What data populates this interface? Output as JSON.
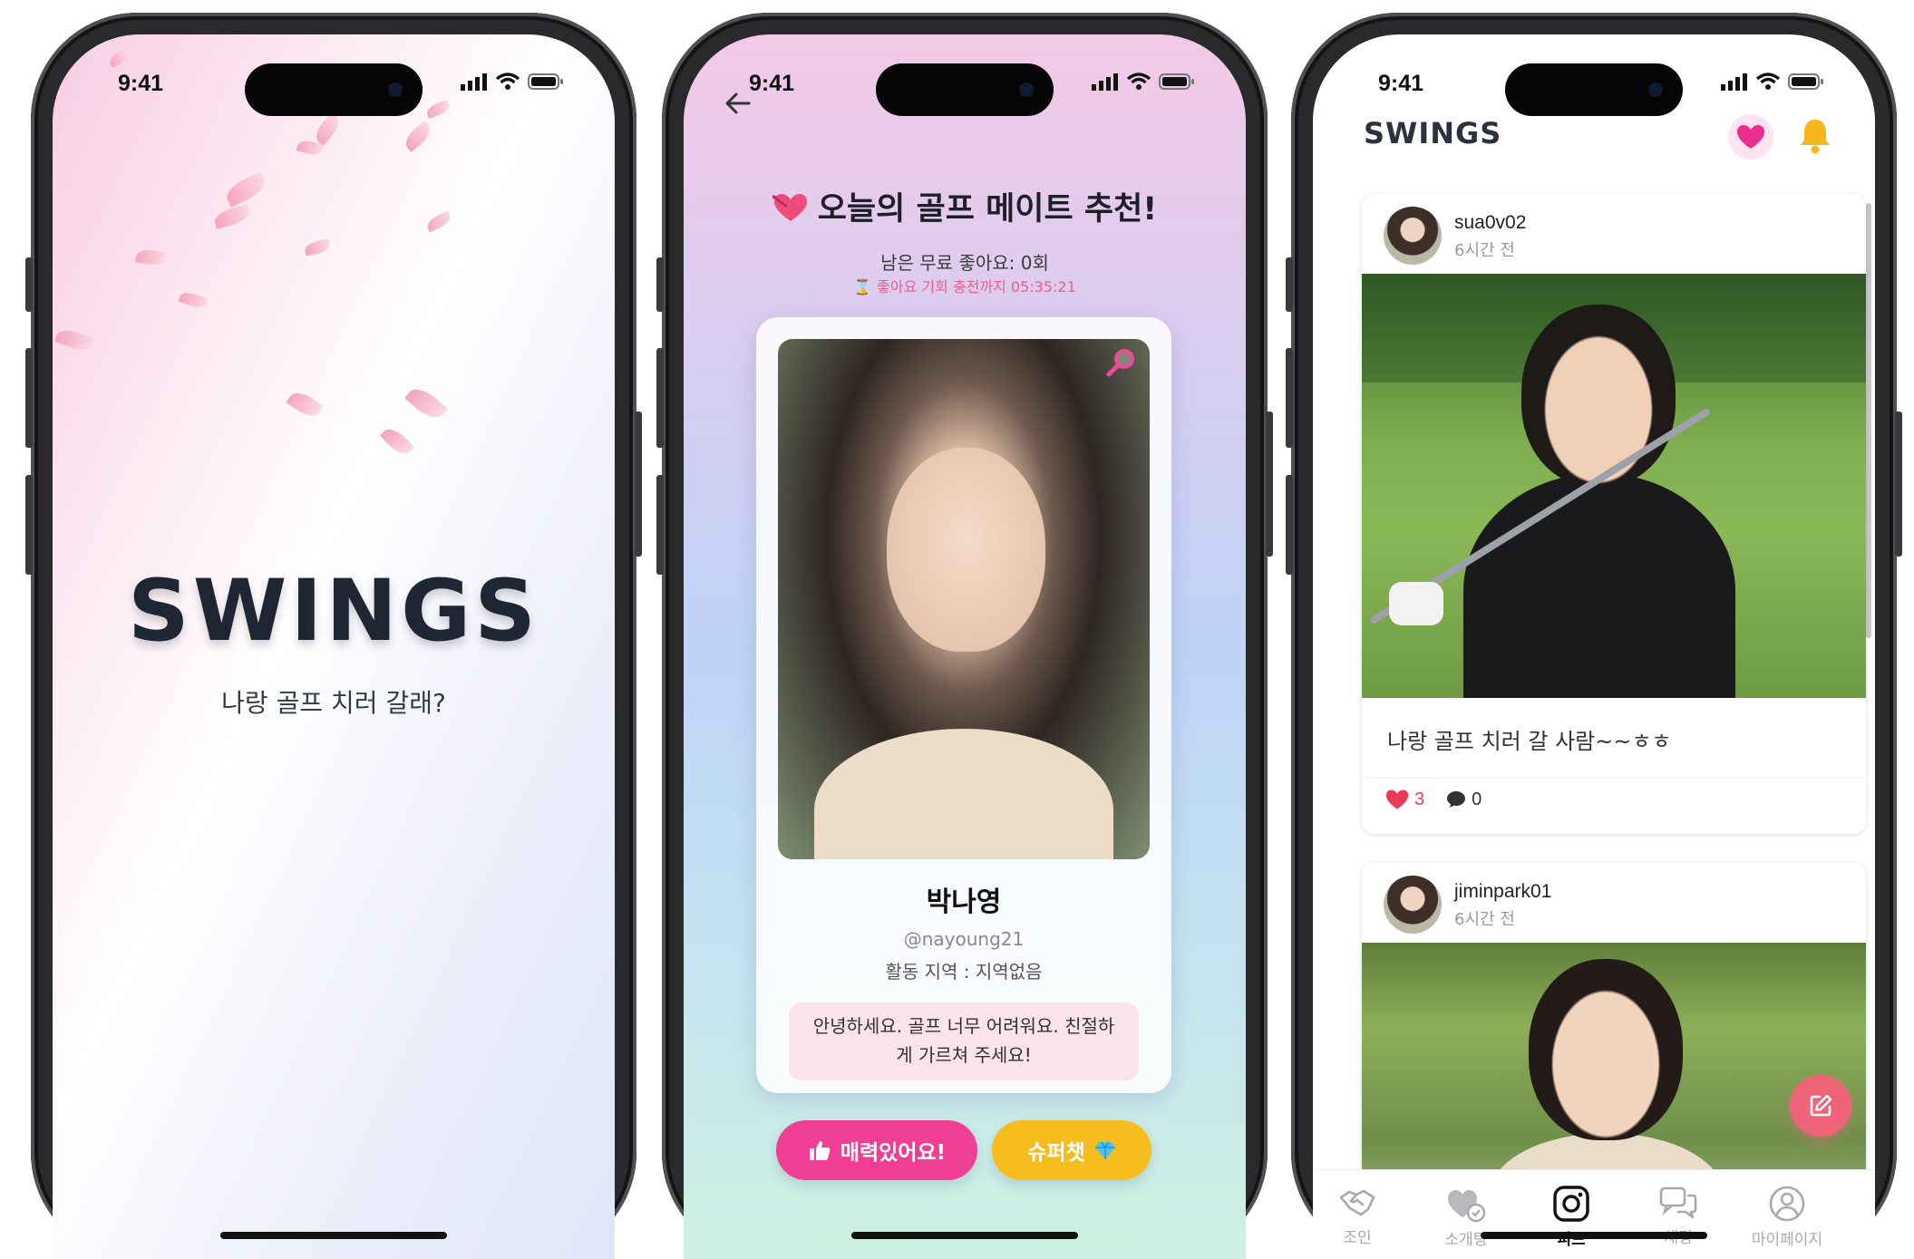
{
  "status": {
    "time": "9:41"
  },
  "splash": {
    "title": "SWINGS",
    "subtitle": "나랑 골프 치러 갈래?"
  },
  "recommend": {
    "title": "오늘의 골프 메이트 추천!",
    "remaining_likes": "남은 무료 좋아요: 0회",
    "recharge_timer": "좋아요 기회 충전까지 05:35:21",
    "profile": {
      "name": "박나영",
      "handle": "@nayoung21",
      "region": "활동 지역 : 지역없음",
      "bio": "안녕하세요. 골프 너무 어려워요. 친절하게 가르쳐 주세요!"
    },
    "like_button": "매력있어요!",
    "super_chat_button": "슈퍼챗"
  },
  "feed": {
    "logo": "SWINGS",
    "posts": [
      {
        "user": "sua0v02",
        "time": "6시간 전",
        "caption": "나랑 골프 치러 갈 사람~~ㅎㅎ",
        "likes": "3",
        "comments": "0"
      },
      {
        "user": "jiminpark01",
        "time": "6시간 전"
      }
    ],
    "tabs": [
      {
        "label": "조인",
        "icon": "handshake-icon"
      },
      {
        "label": "소개팅",
        "icon": "heart-check-icon"
      },
      {
        "label": "피드",
        "icon": "instagram-icon"
      },
      {
        "label": "채팅",
        "icon": "chat-bubbles-icon"
      },
      {
        "label": "마이페이지",
        "icon": "user-circle-icon"
      }
    ],
    "active_tab": "피드"
  },
  "colors": {
    "brand_pink": "#ef3e94",
    "super_yellow": "#f7bd1e",
    "fab_coral": "#f0647a",
    "like_red": "#ea3b5a",
    "bell_yellow": "#f5b81c"
  }
}
